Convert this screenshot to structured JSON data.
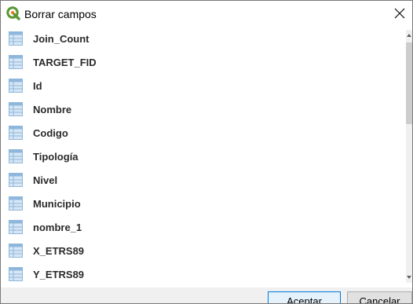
{
  "window": {
    "title": "Borrar campos",
    "close_icon": "close-icon",
    "app_icon": "qgis-icon"
  },
  "fields": [
    {
      "label": "Join_Count"
    },
    {
      "label": "TARGET_FID"
    },
    {
      "label": "Id"
    },
    {
      "label": "Nombre"
    },
    {
      "label": "Codigo"
    },
    {
      "label": "Tipología"
    },
    {
      "label": "Nivel"
    },
    {
      "label": "Municipio"
    },
    {
      "label": "nombre_1"
    },
    {
      "label": "X_ETRS89"
    },
    {
      "label": "Y_ETRS89"
    }
  ],
  "buttons": {
    "accept_label": "Aceptar",
    "cancel_label": "Cancelar"
  },
  "colors": {
    "qgis_green": "#589632",
    "qgis_yellow": "#ee7913",
    "field_icon_blue": "#8fb7dc"
  }
}
